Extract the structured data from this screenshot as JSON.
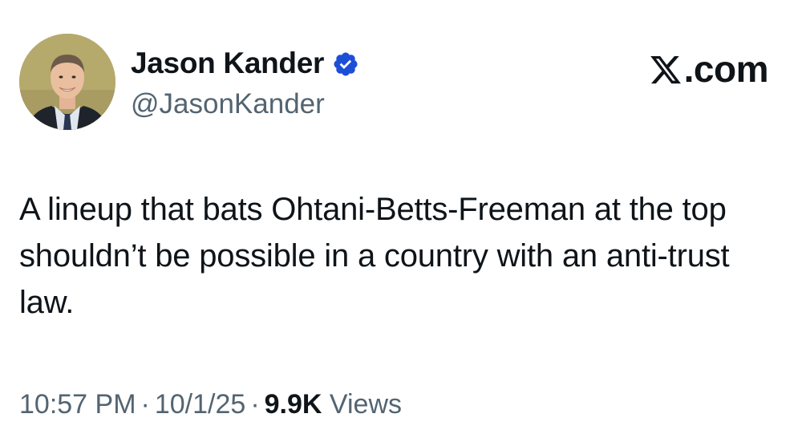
{
  "author": {
    "display_name": "Jason Kander",
    "handle": "@JasonKander",
    "verified": true,
    "verified_icon": "verified-badge-icon",
    "verified_color": "#1d4ed8"
  },
  "source": {
    "logo_icon": "x-logo-icon",
    "suffix": ".com"
  },
  "tweet": {
    "text": "A lineup that bats Ohtani-Betts-Freeman at the top shouldn’t be possible in a country with an anti-trust law."
  },
  "meta": {
    "time": "10:57 PM",
    "separator": "·",
    "date": "10/1/25",
    "views_count": "9.9K",
    "views_label": "Views"
  },
  "colors": {
    "text_primary": "#0f1419",
    "text_secondary": "#536471",
    "background": "#ffffff"
  }
}
